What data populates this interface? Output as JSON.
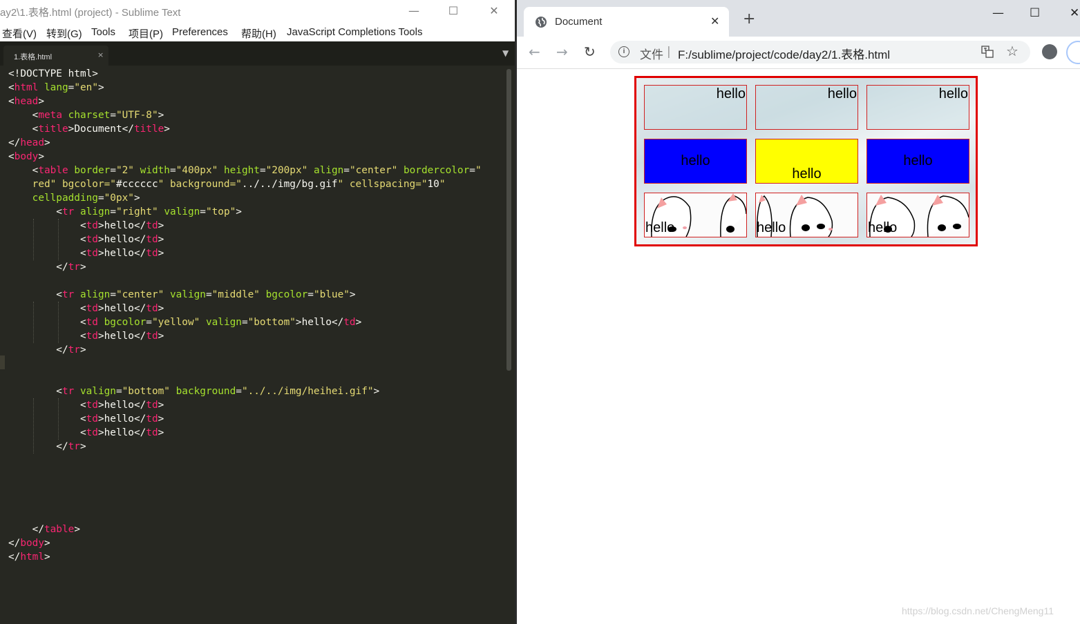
{
  "sublime": {
    "title": "ay2\\1.表格.html (project) - Sublime Text",
    "menu": [
      "查看(V)",
      "转到(G)",
      "Tools",
      "项目(P)",
      "Preferences",
      "帮助(H)",
      "JavaScript Completions Tools"
    ],
    "tab": {
      "label": "1.表格.html",
      "close": "×"
    },
    "dropdown": "▼",
    "code": [
      "<!DOCTYPE html>",
      "<html lang=\"en\">",
      "<head>",
      "    <meta charset=\"UTF-8\">",
      "    <title>Document</title>",
      "</head>",
      "<body>",
      "    <table border=\"2\" width=\"400px\" height=\"200px\" align=\"center\" bordercolor=\"",
      "    red\" bgcolor=\"#cccccc\" background=\"../../img/bg.gif\" cellspacing=\"10\"",
      "    cellpadding=\"0px\">",
      "        <tr align=\"right\" valign=\"top\">",
      "            <td>hello</td>",
      "            <td>hello</td>",
      "            <td>hello</td>",
      "        </tr>",
      "",
      "        <tr align=\"center\" valign=\"middle\" bgcolor=\"blue\">",
      "            <td>hello</td>",
      "            <td bgcolor=\"yellow\" valign=\"bottom\">hello</td>",
      "            <td>hello</td>",
      "        </tr>",
      "",
      "",
      "        <tr valign=\"bottom\" background=\"../../img/heihei.gif\">",
      "            <td>hello</td>",
      "            <td>hello</td>",
      "            <td>hello</td>",
      "        </tr>",
      "",
      "",
      "",
      "",
      "",
      "    </table>",
      "</body>",
      "</html>"
    ]
  },
  "chrome": {
    "tab_title": "Document",
    "tab_close": "✕",
    "new_tab": "+",
    "url_label": "文件",
    "url_separator": "|",
    "url": "F:/sublime/project/code/day2/1.表格.html",
    "star": "☆",
    "table": {
      "rows": [
        [
          "hello",
          "hello",
          "hello"
        ],
        [
          "hello",
          "hello",
          "hello"
        ],
        [
          "hello",
          "hello",
          "hello"
        ]
      ],
      "colors": {
        "border": "#e00000",
        "blue": "#0000ff",
        "yellow": "#ffff00"
      }
    },
    "watermark": "https://blog.csdn.net/ChengMeng11"
  }
}
